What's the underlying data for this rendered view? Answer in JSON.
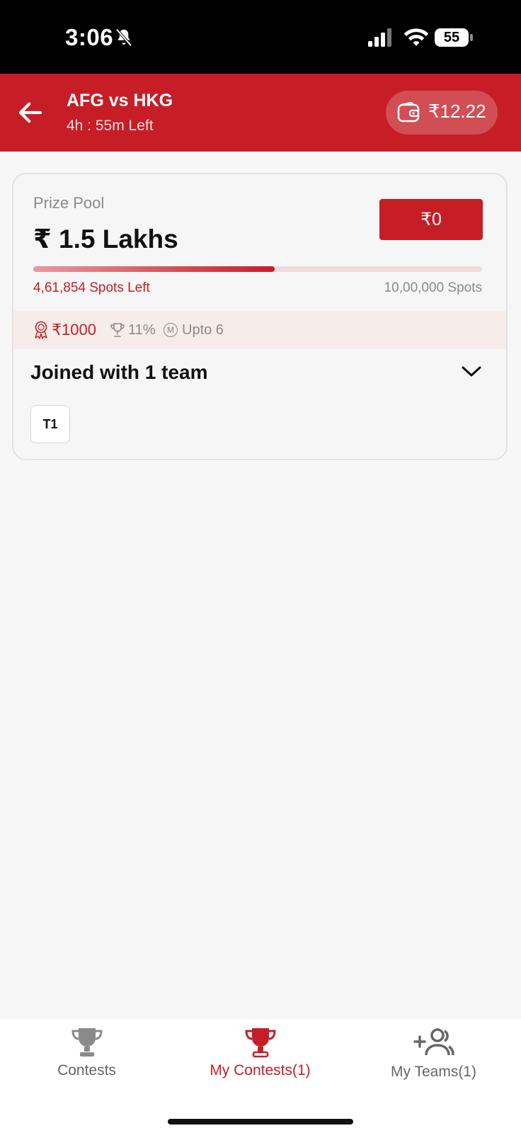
{
  "status_bar": {
    "time": "3:06",
    "battery": "55",
    "icons": [
      "bell-slash-icon",
      "signal-icon",
      "wifi-icon",
      "battery-icon"
    ]
  },
  "header": {
    "title": "AFG vs HKG",
    "subtitle": "4h : 55m Left",
    "wallet_amount": "₹12.22",
    "back_icon": "arrow-left-icon",
    "wallet_icon": "wallet-icon"
  },
  "contest": {
    "prize_pool_label": "Prize Pool",
    "prize_pool_amount": "₹ 1.5 Lakhs",
    "entry_fee": "₹0",
    "spots_left": "4,61,854 Spots Left",
    "total_spots": "10,00,000 Spots",
    "fill_fraction": 0.538,
    "first_prize": "₹1000",
    "winners_percent": "11%",
    "max_entries": "Upto 6",
    "max_badge": "M",
    "joined_text": "Joined with 1 team",
    "teams": [
      "T1"
    ]
  },
  "bottom_nav": {
    "tabs": [
      {
        "label": "Contests",
        "icon": "trophy-icon",
        "active": false
      },
      {
        "label": "My Contests(1)",
        "icon": "trophy-icon",
        "active": true
      },
      {
        "label": "My Teams(1)",
        "icon": "add-user-group-icon",
        "active": false
      }
    ]
  },
  "colors": {
    "brand_red": "#c61d26",
    "background": "#f6f6f6",
    "inactive": "#666666"
  }
}
